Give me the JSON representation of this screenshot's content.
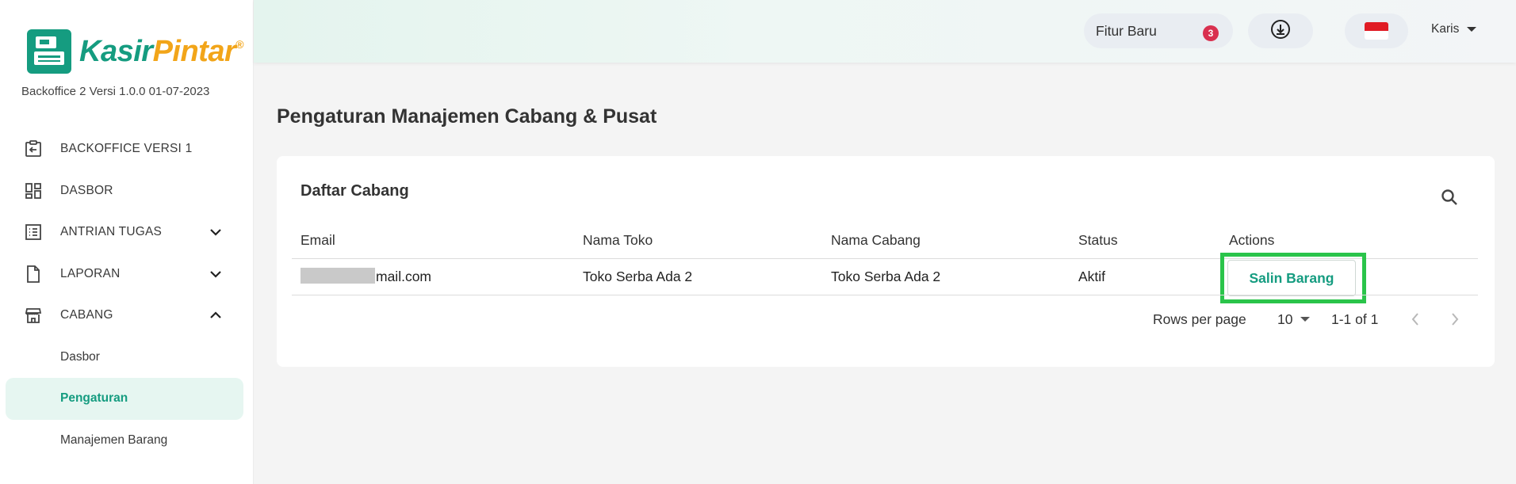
{
  "sidebar": {
    "logo": {
      "part1": "Kasir",
      "part2": "Pintar",
      "reg": "®"
    },
    "version": "Backoffice 2 Versi 1.0.0 01-07-2023",
    "items": [
      {
        "label": "BACKOFFICE VERSI 1",
        "icon": "back-arrow-icon"
      },
      {
        "label": "DASBOR",
        "icon": "dashboard-icon"
      },
      {
        "label": "ANTRIAN TUGAS",
        "icon": "task-list-icon",
        "chevron": "down"
      },
      {
        "label": "LAPORAN",
        "icon": "document-icon",
        "chevron": "down"
      },
      {
        "label": "CABANG",
        "icon": "store-icon",
        "chevron": "up"
      }
    ],
    "sub_items": [
      {
        "label": "Dasbor"
      },
      {
        "label": "Pengaturan",
        "active": true
      },
      {
        "label": "Manajemen Barang"
      }
    ]
  },
  "header": {
    "fitur_label": "Fitur Baru",
    "fitur_count": "3",
    "user_name": "Karis"
  },
  "main": {
    "title": "Pengaturan Manajemen Cabang & Pusat",
    "card_title": "Daftar Cabang",
    "columns": [
      "Email",
      "Nama Toko",
      "Nama Cabang",
      "Status",
      "Actions"
    ],
    "rows": [
      {
        "email_visible": "mail.com",
        "nama_toko": "Toko Serba Ada 2",
        "nama_cabang": "Toko Serba Ada 2",
        "status": "Aktif",
        "action_label": "Salin Barang"
      }
    ],
    "footer": {
      "rows_per_page_label": "Rows per page",
      "rows_per_page": "10",
      "range": "1-1 of 1"
    }
  },
  "colors": {
    "brand_green": "#159c80",
    "brand_orange": "#f2a519",
    "badge_red": "#d9304f",
    "highlight": "#2ac44a"
  }
}
